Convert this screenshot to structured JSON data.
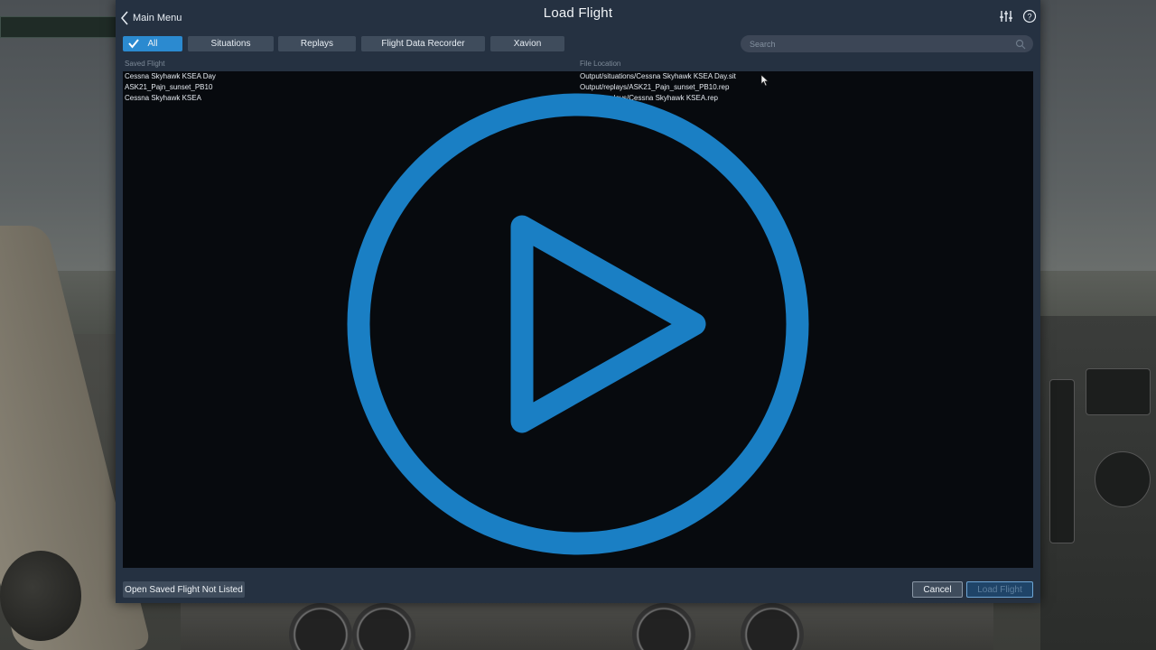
{
  "window": {
    "title": "Load Flight",
    "back_label": "Main Menu"
  },
  "tabs": [
    {
      "label": "All",
      "active": true
    },
    {
      "label": "Situations",
      "active": false
    },
    {
      "label": "Replays",
      "active": false
    },
    {
      "label": "Flight Data Recorder",
      "active": false
    },
    {
      "label": "Xavion",
      "active": false
    }
  ],
  "search": {
    "placeholder": "Search",
    "value": ""
  },
  "table": {
    "headers": [
      "Saved Flight",
      "File Location"
    ],
    "rows": [
      {
        "name": "Cessna Skyhawk KSEA Day",
        "location": "Output/situations/Cessna Skyhawk KSEA Day.sit"
      },
      {
        "name": "ASK21_Pajn_sunset_PB10",
        "location": "Output/replays/ASK21_Pajn_sunset_PB10.rep"
      },
      {
        "name": "Cessna Skyhawk KSEA",
        "location": "Output/replays/Cessna Skyhawk KSEA.rep"
      }
    ]
  },
  "footer": {
    "open_label": "Open Saved Flight Not Listed",
    "cancel_label": "Cancel",
    "load_label": "Load Flight"
  },
  "icons": {
    "back": "chevron-left-icon",
    "settings": "sliders-icon",
    "help": "help-circle-icon",
    "search": "search-icon",
    "check": "checkmark-icon",
    "overlay": "play-circle-icon"
  },
  "colors": {
    "accent": "#2b8ad0",
    "dialog_bg": "#253141",
    "list_bg": "#070a0e",
    "play_overlay": "#1a7fc4"
  }
}
